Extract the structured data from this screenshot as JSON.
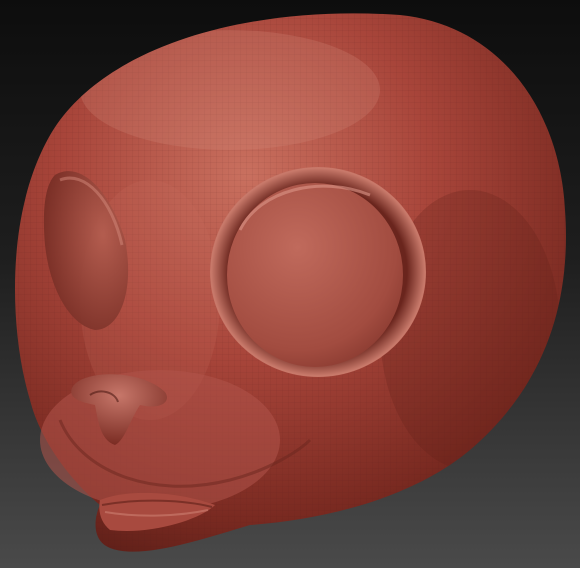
{
  "scene": {
    "subject": "sculpted-head-model",
    "material_base_color": "#a8453a",
    "material_shadow_color": "#5e1f18",
    "material_highlight_color": "#d48a7c",
    "background_top_color": "#0d0d0d",
    "background_bottom_color": "#4a4a4a",
    "wireframe_visible": true
  }
}
